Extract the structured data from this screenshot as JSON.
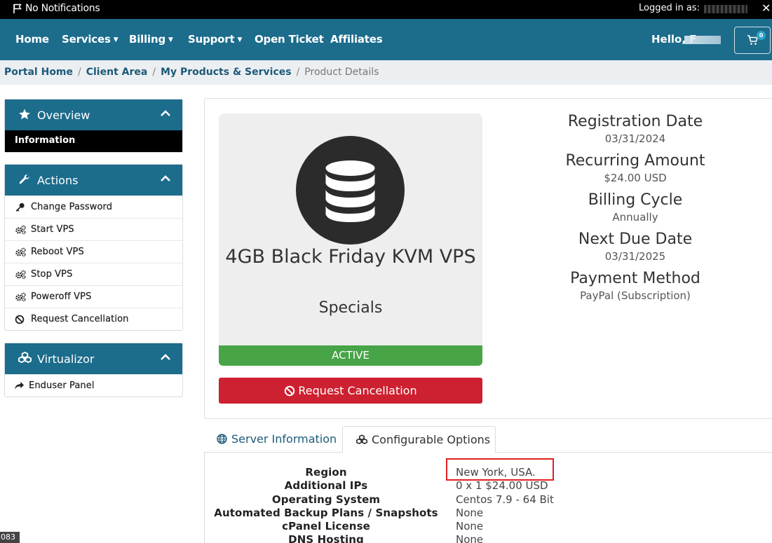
{
  "topbar": {
    "notifications": "No Notifications",
    "logged_in": "Logged in as:"
  },
  "nav": {
    "items": [
      {
        "label": "Home"
      },
      {
        "label": "Services"
      },
      {
        "label": "Billing"
      },
      {
        "label": "Support"
      },
      {
        "label": "Open Ticket"
      },
      {
        "label": "Affiliates"
      }
    ],
    "hello": "Hello, F",
    "cart_count": "0"
  },
  "breadcrumb": {
    "items": [
      "Portal Home",
      "Client Area",
      "My Products & Services"
    ],
    "current": "Product Details"
  },
  "sidebar": {
    "overview": {
      "title": "Overview",
      "active_item": "Information"
    },
    "actions": {
      "title": "Actions",
      "items": [
        "Change Password",
        "Start VPS",
        "Reboot VPS",
        "Stop VPS",
        "Poweroff VPS",
        "Request Cancellation"
      ]
    },
    "virtualizor": {
      "title": "Virtualizor",
      "items": [
        "Enduser Panel"
      ]
    }
  },
  "product": {
    "name": "4GB Black Friday KVM VPS",
    "group": "Specials",
    "status": "ACTIVE",
    "cancel_button": "Request Cancellation"
  },
  "details": [
    {
      "label": "Registration Date",
      "value": "03/31/2024"
    },
    {
      "label": "Recurring Amount",
      "value": "$24.00 USD"
    },
    {
      "label": "Billing Cycle",
      "value": "Annually"
    },
    {
      "label": "Next Due Date",
      "value": "03/31/2025"
    },
    {
      "label": "Payment Method",
      "value": "PayPal (Subscription)"
    }
  ],
  "tabs": {
    "server_info": "Server Information",
    "config_options": "Configurable Options"
  },
  "options": [
    {
      "label": "Region",
      "value": "New York, USA."
    },
    {
      "label": "Additional IPs",
      "value": "0 x 1 $24.00 USD"
    },
    {
      "label": "Operating System",
      "value": "Centos 7.9 - 64 Bit"
    },
    {
      "label": "Automated Backup Plans / Snapshots",
      "value": "None"
    },
    {
      "label": "cPanel License",
      "value": "None"
    },
    {
      "label": "DNS Hosting",
      "value": "None"
    }
  ],
  "corner_label": "083",
  "colors": {
    "nav": "#1c6c8c",
    "active": "#47a447",
    "danger": "#cd2030",
    "highlight": "#e0211f"
  }
}
